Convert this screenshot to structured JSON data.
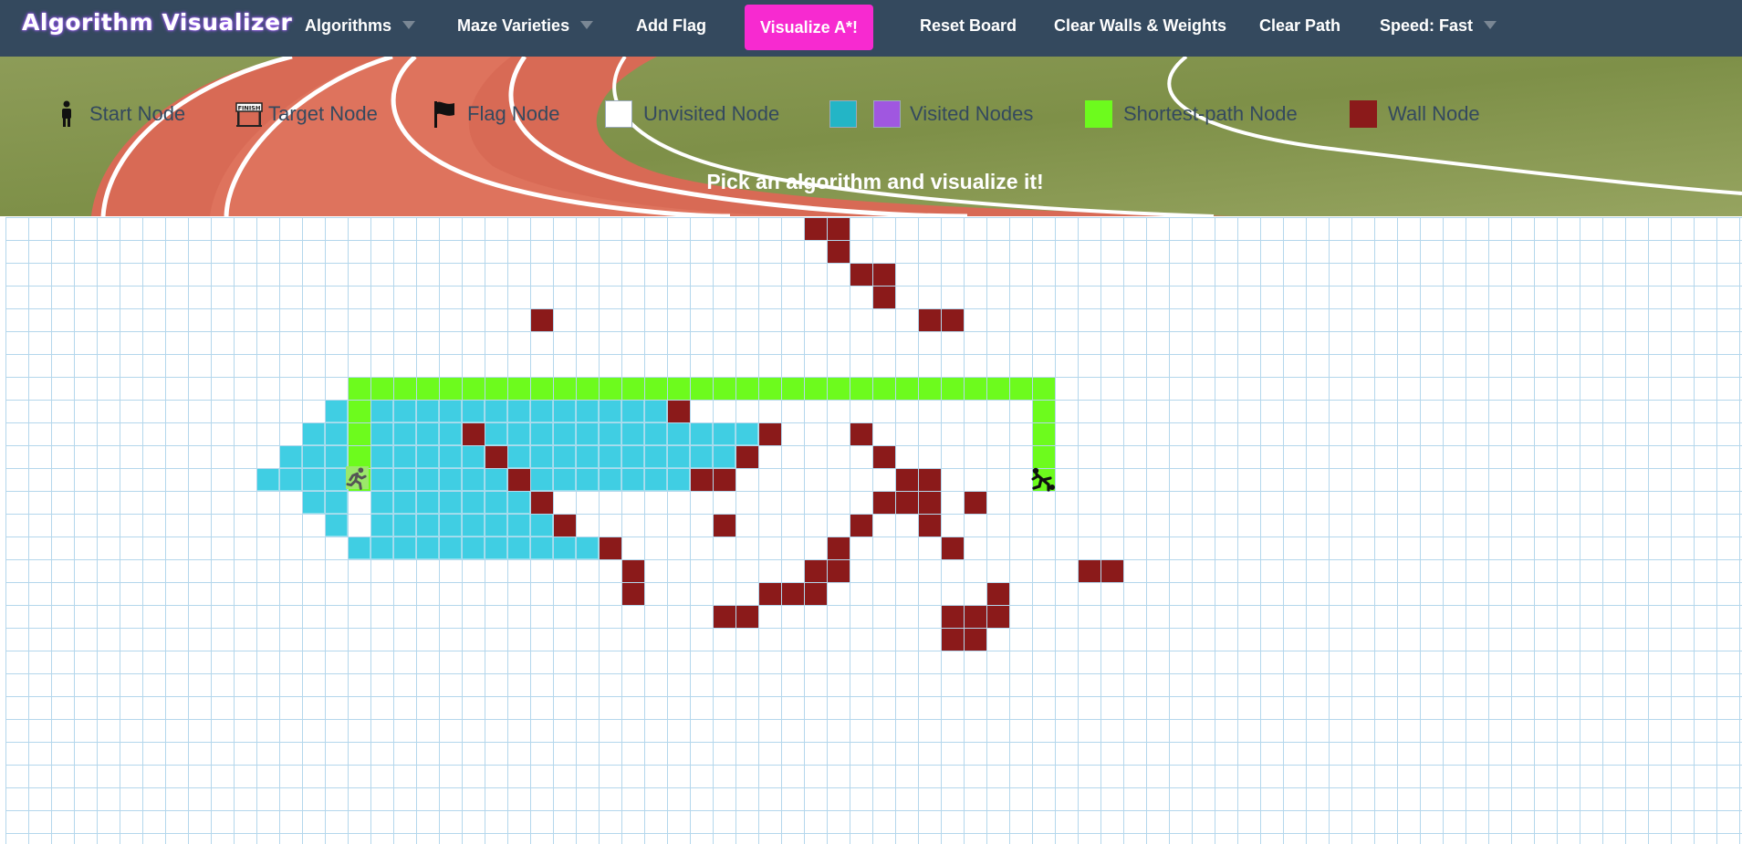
{
  "navbar": {
    "brand": "Algorithm Visualizer",
    "items": [
      {
        "label": "Algorithms",
        "dropdown": true
      },
      {
        "label": "Maze Varieties",
        "dropdown": true
      },
      {
        "label": "Add Flag",
        "dropdown": false
      },
      {
        "label": "Reset Board",
        "dropdown": false
      },
      {
        "label": "Clear Walls & Weights",
        "dropdown": false
      },
      {
        "label": "Clear Path",
        "dropdown": false
      },
      {
        "label": "Speed: Fast",
        "dropdown": true
      }
    ],
    "visualize_label": "Visualize A*!",
    "visualize_color": "#f72ad0"
  },
  "legend": [
    {
      "label": "Start Node",
      "icon": "person-standing-icon"
    },
    {
      "label": "Target Node",
      "icon": "finish-line-icon",
      "icon_text": "FINISH"
    },
    {
      "label": "Flag Node",
      "icon": "flag-icon"
    },
    {
      "label": "Unvisited Node",
      "icon": "unvisited-swatch",
      "color": "#ffffff"
    },
    {
      "label": "Visited Nodes",
      "icon": "visited-swatches",
      "colors": [
        "#23b5c6",
        "#a057e0"
      ]
    },
    {
      "label": "Shortest-path Node",
      "icon": "shortest-path-swatch",
      "color": "#6dfb1d"
    },
    {
      "label": "Wall Node",
      "icon": "wall-swatch",
      "color": "#8b1a1a"
    }
  ],
  "tagline": "Pick an algorithm and visualize it!",
  "colors": {
    "navbar_bg": "#34495e",
    "visited": "#40cee3",
    "wall": "#8b1a1a",
    "shortest_path": "#6dfb1d",
    "grid_line": "#b4d7ec"
  },
  "grid": {
    "start_node": {
      "row": 11,
      "col": 15,
      "icon": "running-man-icon"
    },
    "target_node": {
      "row": 11,
      "col": 45,
      "icon": "runner-finishing-icon"
    }
  }
}
